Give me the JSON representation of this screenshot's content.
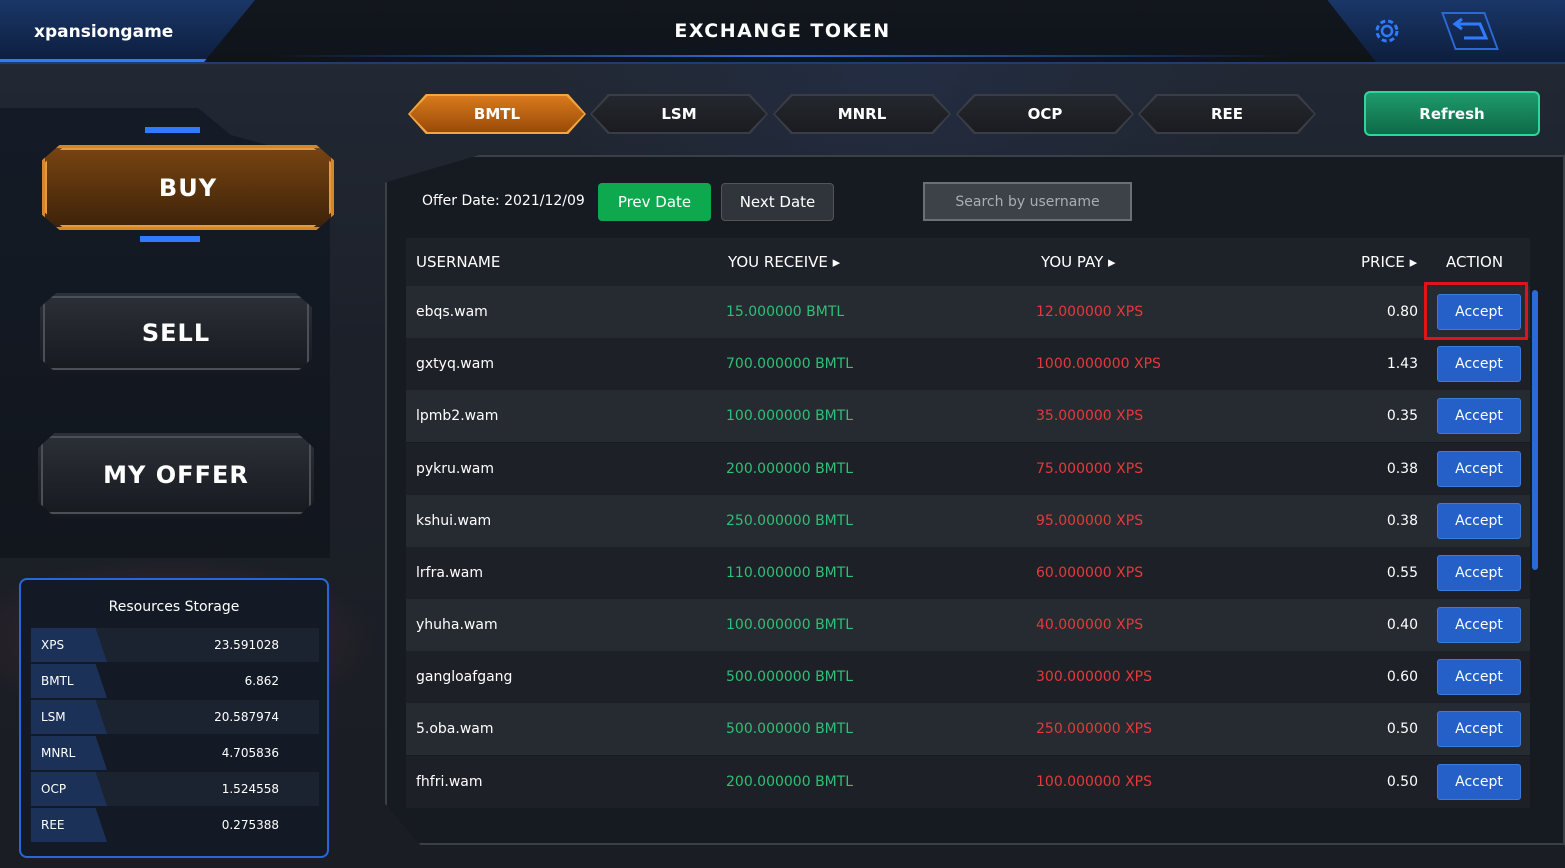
{
  "header": {
    "username": "xpansiongame",
    "title": "EXCHANGE TOKEN",
    "icons": [
      "gear-icon",
      "back-arrow-icon"
    ]
  },
  "sidebar": {
    "buy_label": "BUY",
    "sell_label": "SELL",
    "my_offer_label": "MY OFFER"
  },
  "resources": {
    "title": "Resources Storage",
    "items": [
      {
        "name": "XPS",
        "value": "23.591028"
      },
      {
        "name": "BMTL",
        "value": "6.862"
      },
      {
        "name": "LSM",
        "value": "20.587974"
      },
      {
        "name": "MNRL",
        "value": "4.705836"
      },
      {
        "name": "OCP",
        "value": "1.524558"
      },
      {
        "name": "REE",
        "value": "0.275388"
      }
    ]
  },
  "tabs": [
    {
      "label": "BMTL",
      "active": true
    },
    {
      "label": "LSM",
      "active": false
    },
    {
      "label": "MNRL",
      "active": false
    },
    {
      "label": "OCP",
      "active": false
    },
    {
      "label": "REE",
      "active": false
    }
  ],
  "refresh_label": "Refresh",
  "filters": {
    "offer_date": "Offer Date: 2021/12/09",
    "prev_label": "Prev Date",
    "next_label": "Next Date",
    "search_placeholder": "Search by username"
  },
  "table": {
    "headers": {
      "username": "USERNAME",
      "receive": "YOU RECEIVE ▸",
      "pay": "YOU PAY ▸",
      "price": "PRICE ▸",
      "action": "ACTION"
    },
    "accept_label": "Accept",
    "rows": [
      {
        "username": "ebqs.wam",
        "receive": "15.000000 BMTL",
        "pay": "12.000000 XPS",
        "price": "0.80"
      },
      {
        "username": "gxtyq.wam",
        "receive": "700.000000 BMTL",
        "pay": "1000.000000 XPS",
        "price": "1.43"
      },
      {
        "username": "lpmb2.wam",
        "receive": "100.000000 BMTL",
        "pay": "35.000000 XPS",
        "price": "0.35"
      },
      {
        "username": "pykru.wam",
        "receive": "200.000000 BMTL",
        "pay": "75.000000 XPS",
        "price": "0.38"
      },
      {
        "username": "kshui.wam",
        "receive": "250.000000 BMTL",
        "pay": "95.000000 XPS",
        "price": "0.38"
      },
      {
        "username": "lrfra.wam",
        "receive": "110.000000 BMTL",
        "pay": "60.000000 XPS",
        "price": "0.55"
      },
      {
        "username": "yhuha.wam",
        "receive": "100.000000 BMTL",
        "pay": "40.000000 XPS",
        "price": "0.40"
      },
      {
        "username": "gangloafgang",
        "receive": "500.000000 BMTL",
        "pay": "300.000000 XPS",
        "price": "0.60"
      },
      {
        "username": "5.oba.wam",
        "receive": "500.000000 BMTL",
        "pay": "250.000000 XPS",
        "price": "0.50"
      },
      {
        "username": "fhfri.wam",
        "receive": "200.000000 BMTL",
        "pay": "100.000000 XPS",
        "price": "0.50"
      }
    ]
  }
}
